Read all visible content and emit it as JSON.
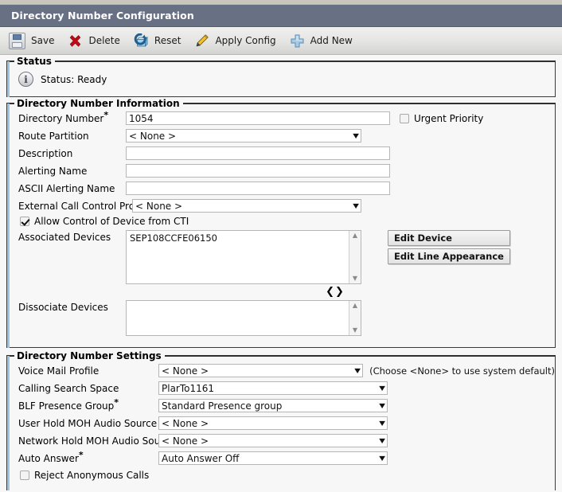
{
  "window": {
    "title": "Directory Number Configuration"
  },
  "toolbar": {
    "buttons": [
      {
        "label": "Save",
        "icon": "save-icon"
      },
      {
        "label": "Delete",
        "icon": "delete-icon"
      },
      {
        "label": "Reset",
        "icon": "reset-icon"
      },
      {
        "label": "Apply Config",
        "icon": "apply-config-icon"
      },
      {
        "label": "Add New",
        "icon": "add-new-icon"
      }
    ]
  },
  "status": {
    "legend": "Status",
    "icon": "info-icon",
    "text": "Status: Ready"
  },
  "dn_information": {
    "legend": "Directory Number Information",
    "fields": {
      "directory_number": {
        "label": "Directory Number",
        "required": true,
        "value": "1054"
      },
      "route_partition": {
        "label": "Route Partition",
        "required": false,
        "value": "< None >"
      },
      "description": {
        "label": "Description",
        "required": false,
        "value": ""
      },
      "alerting_name": {
        "label": "Alerting Name",
        "required": false,
        "value": ""
      },
      "ascii_alerting_name": {
        "label": "ASCII Alerting Name",
        "required": false,
        "value": ""
      },
      "external_call_control_profile": {
        "label": "External Call Control Profile",
        "required": false,
        "value": "< None >"
      },
      "associated_devices": {
        "label": "Associated Devices",
        "items": [
          "SEP108CCFE06150"
        ]
      },
      "dissociate_devices": {
        "label": "Dissociate Devices",
        "items": []
      }
    },
    "urgent_priority": {
      "label": "Urgent Priority",
      "checked": false
    },
    "allow_cti": {
      "label": "Allow Control of Device from CTI",
      "checked": true
    },
    "buttons": {
      "edit_device": "Edit Device",
      "edit_line_appearance": "Edit Line Appearance"
    },
    "move_down_icon": "chevron-down-icon",
    "move_up_icon": "chevron-up-icon"
  },
  "dn_settings": {
    "legend": "Directory Number Settings",
    "note": "(Choose <None> to use system default)",
    "fields": {
      "voice_mail_profile": {
        "label": "Voice Mail Profile",
        "required": false,
        "value": "< None >"
      },
      "calling_search_space": {
        "label": "Calling Search Space",
        "required": false,
        "value": "PlarTo1161"
      },
      "blf_presence_group": {
        "label": "BLF Presence Group",
        "required": true,
        "value": "Standard Presence group"
      },
      "user_hold_moh": {
        "label": "User Hold MOH Audio Source",
        "required": false,
        "value": "< None >"
      },
      "network_hold_moh": {
        "label": "Network Hold MOH Audio Source",
        "required": false,
        "value": "< None >"
      },
      "auto_answer": {
        "label": "Auto Answer",
        "required": true,
        "value": "Auto Answer Off"
      }
    },
    "reject_anonymous": {
      "label": "Reject Anonymous Calls",
      "checked": false
    }
  },
  "colors": {
    "titlebar": "#687084",
    "accent_blue": "#9dc7e0",
    "page_bg": "#f7f7f7"
  }
}
